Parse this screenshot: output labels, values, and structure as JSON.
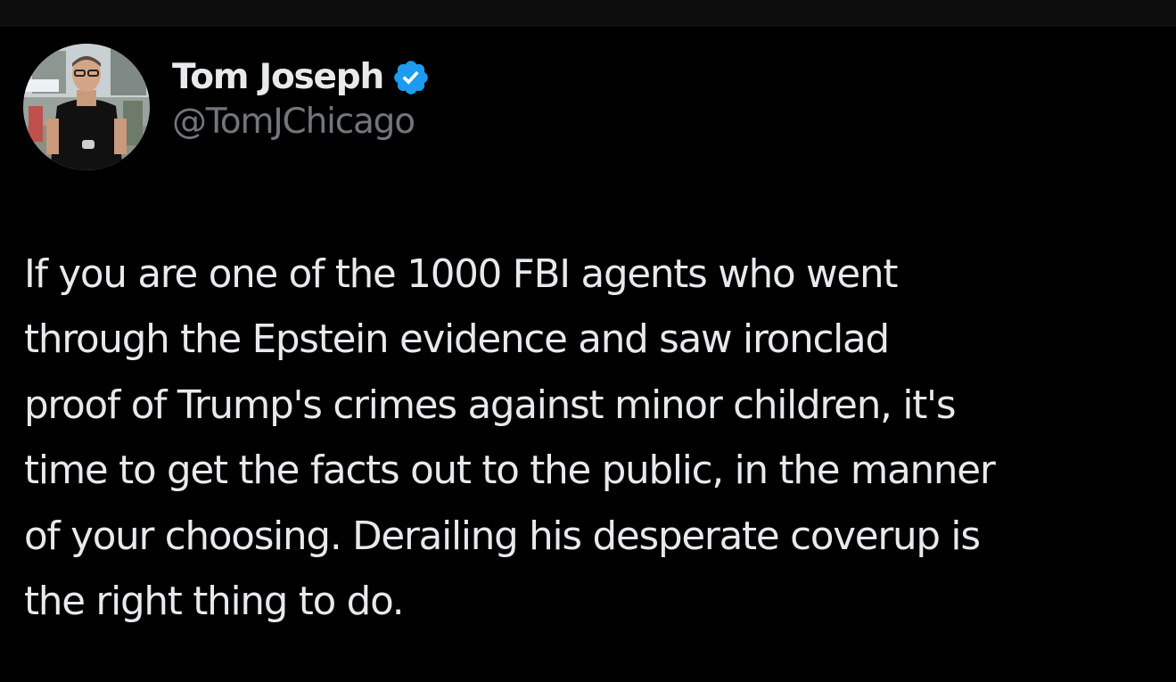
{
  "author": {
    "display_name": "Tom Joseph",
    "handle": "@TomJChicago",
    "verified_icon": "verified-badge-icon",
    "verified_color": "#1d9bf0",
    "avatar": "profile-photo"
  },
  "tweet": {
    "lines": [
      "If you are one of the 1000 FBI agents who went",
      "through the Epstein evidence and saw ironclad",
      "proof of Trump's crimes against minor children, it's",
      "time to get the facts out to the public, in the manner",
      "of your choosing. Derailing his desperate coverup is",
      "the right thing to do."
    ]
  },
  "colors": {
    "background": "#000000",
    "text_primary": "#e7e9ea",
    "text_secondary": "#71767b"
  }
}
